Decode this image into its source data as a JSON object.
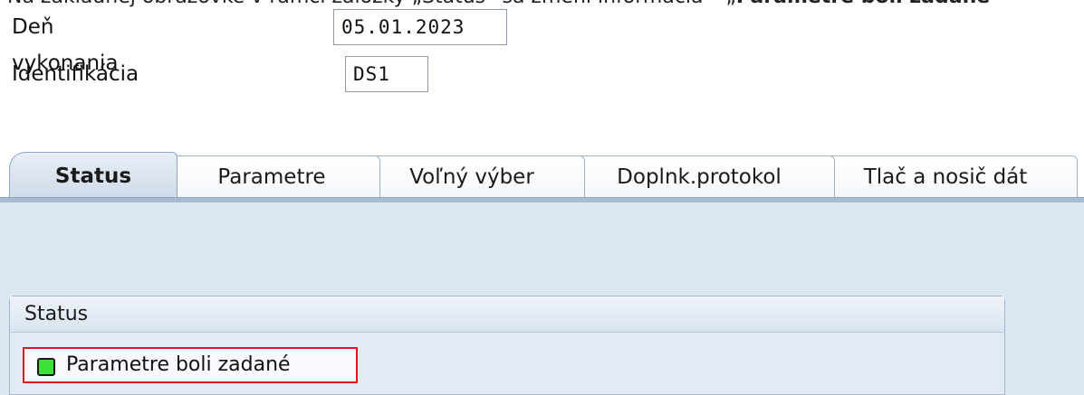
{
  "caption": {
    "text_start": "Na základnej obrazovke v rámci záložky „Status“ sa zmení informácia – „",
    "text_bold": "Parametre boli zadané"
  },
  "form": {
    "execution_date_label": "Deň vykonania",
    "execution_date_value": "05.01.2023",
    "identification_label": "Identifikácia",
    "identification_value": "DS1"
  },
  "tabs": [
    {
      "label": "Status",
      "active": true
    },
    {
      "label": "Parametre",
      "active": false
    },
    {
      "label": "Voľný výber",
      "active": false
    },
    {
      "label": "Doplnk.protokol",
      "active": false
    },
    {
      "label": "Tlač a nosič dát",
      "active": false
    }
  ],
  "status_panel": {
    "title": "Status",
    "message": "Parametre boli zadané",
    "light_color": "#3ee03a",
    "light_icon": "green-status-light-icon",
    "highlight_color": "#e0141e"
  }
}
